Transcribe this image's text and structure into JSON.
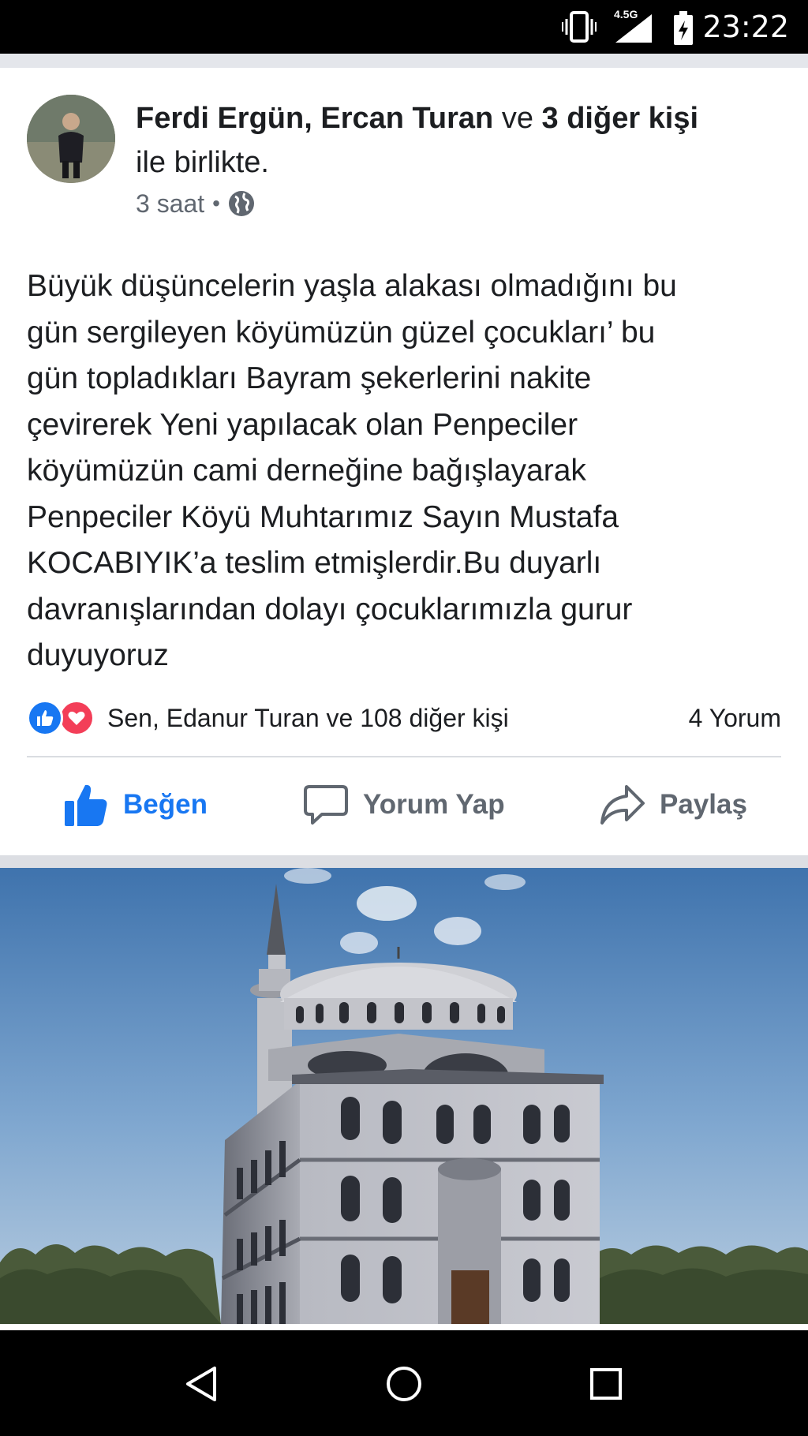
{
  "status_bar": {
    "network_label": "4.5G",
    "time": "23:22"
  },
  "post": {
    "author_names": "Ferdi Ergün, Ercan Turan",
    "author_conj": " ve ",
    "author_others": "3 diğer kişi",
    "author_suffix": "ile birlikte.",
    "timestamp": "3 saat",
    "meta_separator": "•",
    "privacy_icon": "globe-icon",
    "text": "Büyük düşüncelerin yaşla alakası olmadığını bu\ngün sergileyen köyümüzün güzel çocukları’ bu\ngün topladıkları Bayram şekerlerini nakite\nçevirerek Yeni yapılacak olan Penpeciler\nköyümüzün cami derneğine bağışlayarak\nPenpeciler Köyü Muhtarımız Sayın Mustafa\nKOCABIYIK’a teslim etmişlerdir.Bu duyarlı\ndavranışlarından dolayı çocuklarımızla gurur\nduyuyoruz",
    "reactions_text": "Sen, Edanur Turan ve 108 diğer kişi",
    "comments_count": "4 Yorum"
  },
  "actions": {
    "like_label": "Beğen",
    "comment_label": "Yorum Yap",
    "share_label": "Paylaş"
  },
  "colors": {
    "accent": "#1877f2",
    "love": "#f33e58",
    "text_primary": "#1c1e21",
    "text_secondary": "#606770"
  }
}
